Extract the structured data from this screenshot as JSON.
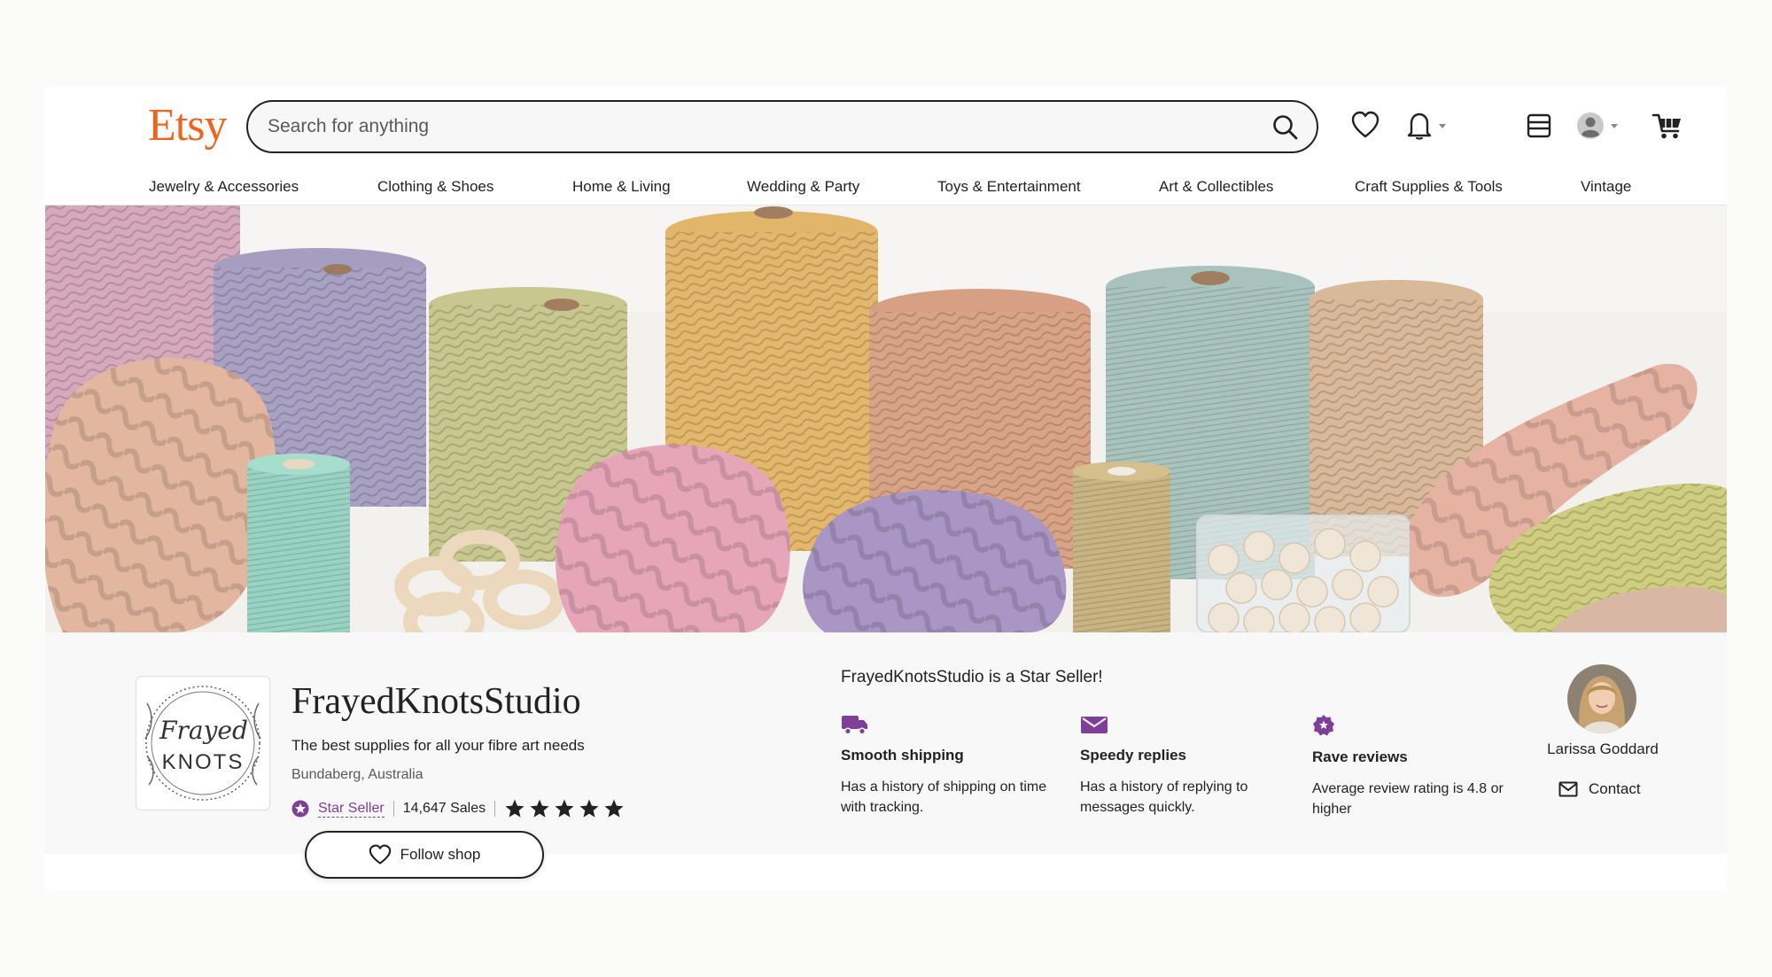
{
  "header": {
    "logo": "Etsy",
    "search_placeholder": "Search for anything"
  },
  "nav": {
    "items": [
      "Jewelry & Accessories",
      "Clothing & Shoes",
      "Home & Living",
      "Wedding & Party",
      "Toys & Entertainment",
      "Art & Collectibles",
      "Craft Supplies & Tools",
      "Vintage"
    ]
  },
  "shop": {
    "logo_line1": "Frayed",
    "logo_line2": "KNOTS",
    "name": "FrayedKnotsStudio",
    "tagline": "The best supplies for all your fibre art needs",
    "location": "Bundaberg, Australia",
    "star_seller_label": "Star Seller",
    "sales": "14,647 Sales",
    "rating_stars": 5,
    "follow_label": "Follow shop"
  },
  "star_seller": {
    "heading": "FrayedKnotsStudio is a Star Seller!",
    "features": [
      {
        "title": "Smooth shipping",
        "desc": "Has a history of shipping on time with tracking.",
        "icon": "truck-icon"
      },
      {
        "title": "Speedy replies",
        "desc": "Has a history of replying to messages quickly.",
        "icon": "envelope-icon"
      },
      {
        "title": "Rave reviews",
        "desc": "Average review rating is 4.8 or higher",
        "icon": "star-badge-icon"
      }
    ]
  },
  "owner": {
    "name": "Larissa Goddard",
    "contact_label": "Contact"
  },
  "colors": {
    "brand": "#f1641e",
    "star_seller": "#7f3e98",
    "text": "#222222"
  }
}
